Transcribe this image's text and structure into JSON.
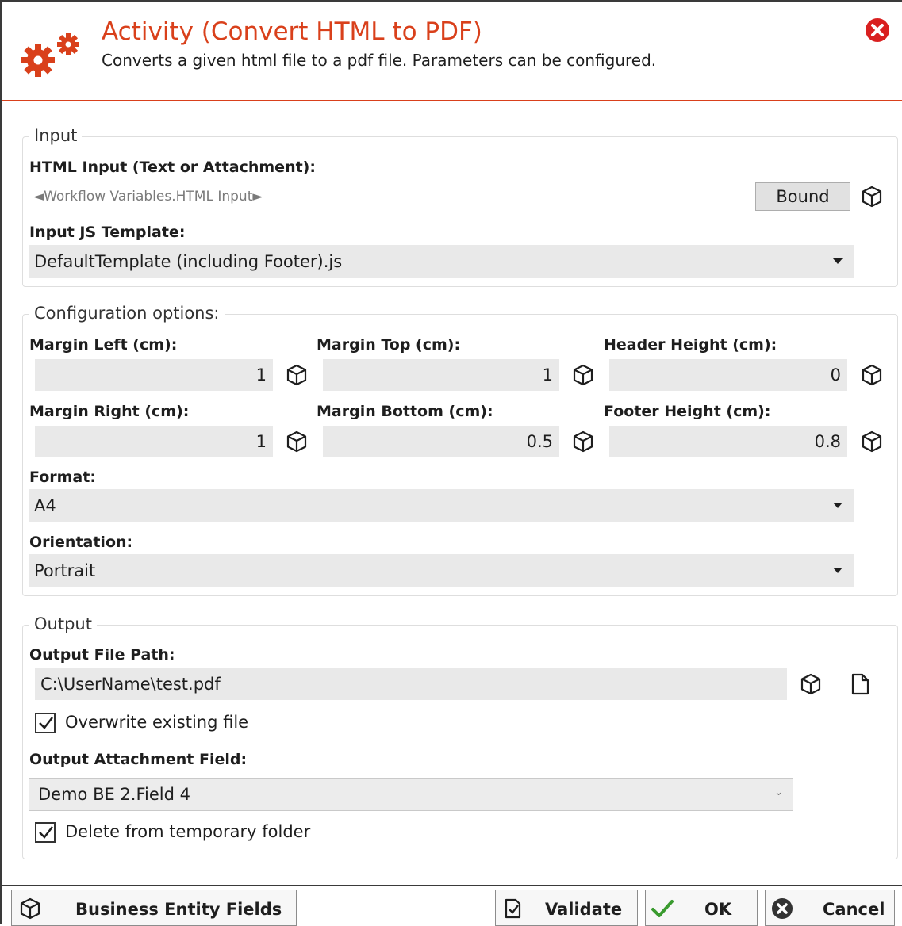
{
  "header": {
    "title": "Activity (Convert HTML to PDF)",
    "subtitle": "Converts a given html file to a pdf file. Parameters can be configured."
  },
  "input_group": {
    "legend": "Input",
    "html_input_label": "HTML Input (Text or Attachment):",
    "html_input_value": "◄Workflow Variables.HTML Input►",
    "bound_button": "Bound",
    "js_template_label": "Input JS Template:",
    "js_template_value": "DefaultTemplate (including Footer).js"
  },
  "config_group": {
    "legend": "Configuration options:",
    "margin_left_label": "Margin Left (cm):",
    "margin_left_value": "1",
    "margin_top_label": "Margin Top (cm):",
    "margin_top_value": "1",
    "header_height_label": "Header Height (cm):",
    "header_height_value": "0",
    "margin_right_label": "Margin Right (cm):",
    "margin_right_value": "1",
    "margin_bottom_label": "Margin Bottom (cm):",
    "margin_bottom_value": "0.5",
    "footer_height_label": "Footer Height (cm):",
    "footer_height_value": "0.8",
    "format_label": "Format:",
    "format_value": "A4",
    "orientation_label": "Orientation:",
    "orientation_value": "Portrait"
  },
  "output_group": {
    "legend": "Output",
    "file_path_label": "Output File Path:",
    "file_path_value": "C:\\UserName\\test.pdf",
    "overwrite_label": "Overwrite existing file",
    "overwrite_checked": true,
    "attachment_field_label": "Output Attachment Field:",
    "attachment_field_value": "Demo BE 2.Field 4",
    "delete_temp_label": "Delete from temporary folder",
    "delete_temp_checked": true
  },
  "footer": {
    "business_entity_fields": "Business Entity Fields",
    "validate": "Validate",
    "ok": "OK",
    "cancel": "Cancel"
  },
  "colors": {
    "accent": "#d9401b",
    "field_bg": "#e9e9e9",
    "ok_green": "#3a9b2f",
    "close_red": "#d92020"
  },
  "icons": [
    "gears-icon",
    "close-icon",
    "cube-icon",
    "dropdown-arrow-icon",
    "file-icon",
    "checkmark-icon",
    "validate-icon",
    "ok-check-icon",
    "cancel-icon"
  ]
}
